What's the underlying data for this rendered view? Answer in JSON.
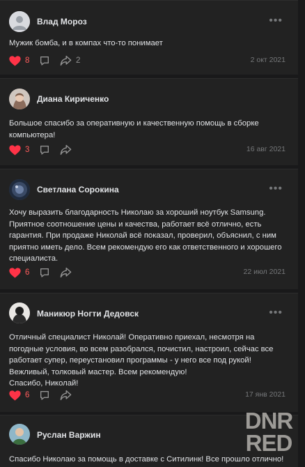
{
  "posts": [
    {
      "author": "Влад Мороз",
      "text": "Мужик бомба, и в компах что-то понимает",
      "likes": "8",
      "shares": "2",
      "date": "2 окт 2021",
      "avatar": "default-avatar"
    },
    {
      "author": "Диана Кириченко",
      "text": "Большое спасибо за оперативную и качественную помощь в сборке компьютера!",
      "likes": "3",
      "shares": "",
      "date": "16 авг 2021",
      "avatar": "photo-avatar"
    },
    {
      "author": "Светлана Сорокина",
      "text": "Хочу выразить благодарность Николаю за хороший ноутбук Samsung. Приятное соотношение цены и качества, работает всё отлично, есть гарантия. При продаже Николай всё показал, проверил, объяснил, с ним приятно иметь дело. Всем рекомендую его как ответственного и хорошего специалиста.",
      "likes": "6",
      "shares": "",
      "date": "22 июл 2021",
      "avatar": "photo-avatar"
    },
    {
      "author": "Маникюр Ногти Дедовск",
      "text": "Отличный специалист Николай! Оперативно приехал, несмотря на погодные условия, во всем разобрался, почистил, настроил, сейчас все работает супер, переустановил программы - у него все под рукой! Вежливый, толковый мастер. Всем рекомендую!\nСпасибо, Николай!",
      "likes": "6",
      "shares": "",
      "date": "17 янв 2021",
      "avatar": "photo-avatar"
    },
    {
      "author": "Руслан Варжин",
      "text": "Спасибо Николаю за помощь в доставке с Ситилинк! Все прошло отлично!",
      "likes": "",
      "shares": "",
      "date": "",
      "avatar": "photo-avatar"
    }
  ],
  "more_label": "•••",
  "watermark": {
    "line1": "DNR",
    "line2": "RED"
  },
  "colors": {
    "like_red": "#ff3347",
    "icon_gray": "#939393",
    "background": "#19191a",
    "card": "#222222"
  }
}
